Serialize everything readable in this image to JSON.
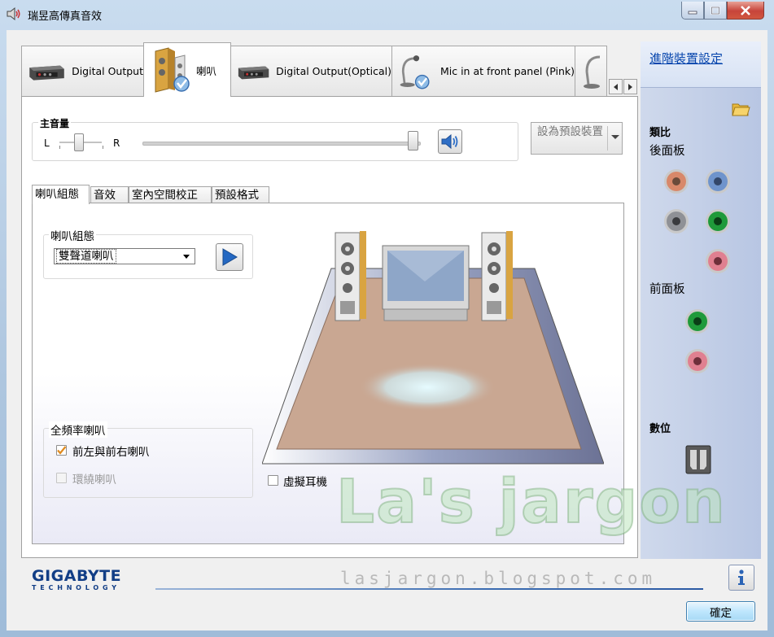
{
  "window": {
    "title": "瑞昱高傳真音效"
  },
  "device_tabs": [
    {
      "label": "Digital Output",
      "icon": "digital-output-device-icon"
    },
    {
      "label": "喇叭",
      "icon": "speakers-device-icon",
      "active": true
    },
    {
      "label": "Digital Output(Optical)",
      "icon": "optical-output-device-icon"
    },
    {
      "label": "Mic in at front panel (Pink)",
      "icon": "microphone-device-icon"
    }
  ],
  "volume": {
    "group_label": "主音量",
    "left_label": "L",
    "right_label": "R",
    "balance_fraction": 0.5,
    "level_fraction": 1.0
  },
  "default_device": {
    "label": "設為預設裝置"
  },
  "sub_tabs": [
    "喇叭組態",
    "音效",
    "室內空間校正",
    "預設格式"
  ],
  "speaker_config": {
    "group_label": "喇叭組態",
    "selected": "雙聲道喇叭"
  },
  "full_range": {
    "group_label": "全頻率喇叭",
    "front_label": "前左與前右喇叭",
    "front_checked": true,
    "surround_label": "環繞喇叭",
    "surround_checked": false,
    "surround_enabled": false
  },
  "virtual_headphone": {
    "label": "虛擬耳機",
    "checked": false
  },
  "right_panel": {
    "advanced_link": "進階裝置設定",
    "analog_heading": "類比",
    "rear_panel": "後面板",
    "front_panel": "前面板",
    "digital_heading": "數位",
    "rear_jacks": [
      "#d8886a",
      "#6f94cc",
      "#8f9196",
      "#1f9a3a",
      "#e08090"
    ],
    "front_jacks": [
      "#1f9a3a",
      "#e08090"
    ]
  },
  "branding": {
    "brand": "GIGABYTE",
    "sub": "TECHNOLOGY"
  },
  "buttons": {
    "ok": "確定"
  },
  "watermark": {
    "title": "La's jargon",
    "sub": "lasjargon.blogspot.com"
  }
}
